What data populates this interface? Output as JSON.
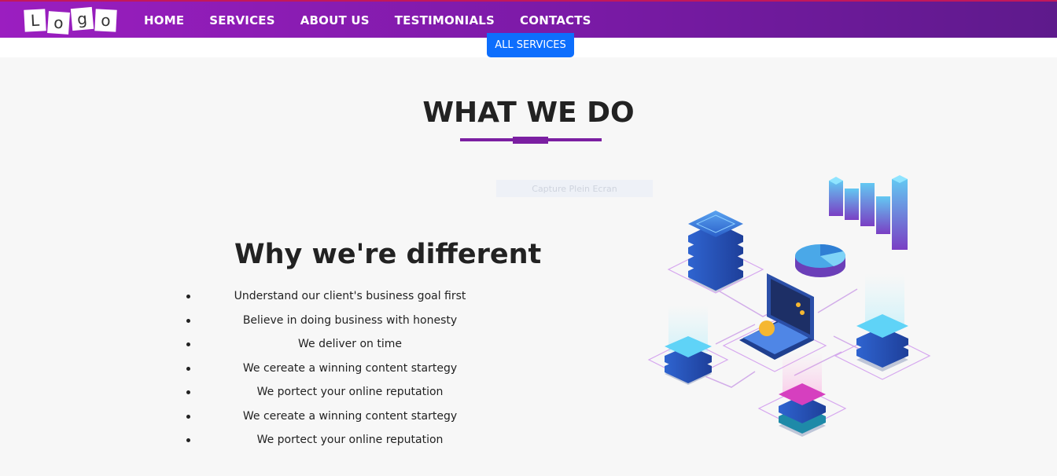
{
  "navbar": {
    "logo_letters": [
      "L",
      "o",
      "g",
      "o"
    ],
    "links": [
      "HOME",
      "SERVICES",
      "ABOUT US",
      "TESTIMONIALS",
      "CONTACTS"
    ]
  },
  "all_services_label": "ALL SERVICES",
  "section": {
    "title": "WHAT WE DO",
    "faint_label": "Capture Plein Ecran"
  },
  "why": {
    "title": "Why we're different",
    "items": [
      "Understand our client's business goal first",
      "Believe in doing business with honesty",
      "We deliver on time",
      "We cereate a winning content startegy",
      "We portect your online reputation",
      "We cereate a winning content startegy",
      "We portect your online reputation"
    ]
  },
  "colors": {
    "nav_gradient_start": "#9b1ec0",
    "nav_gradient_end": "#5e1a8c",
    "button_blue": "#0d6efd",
    "accent_purple": "#7b1fa2"
  }
}
